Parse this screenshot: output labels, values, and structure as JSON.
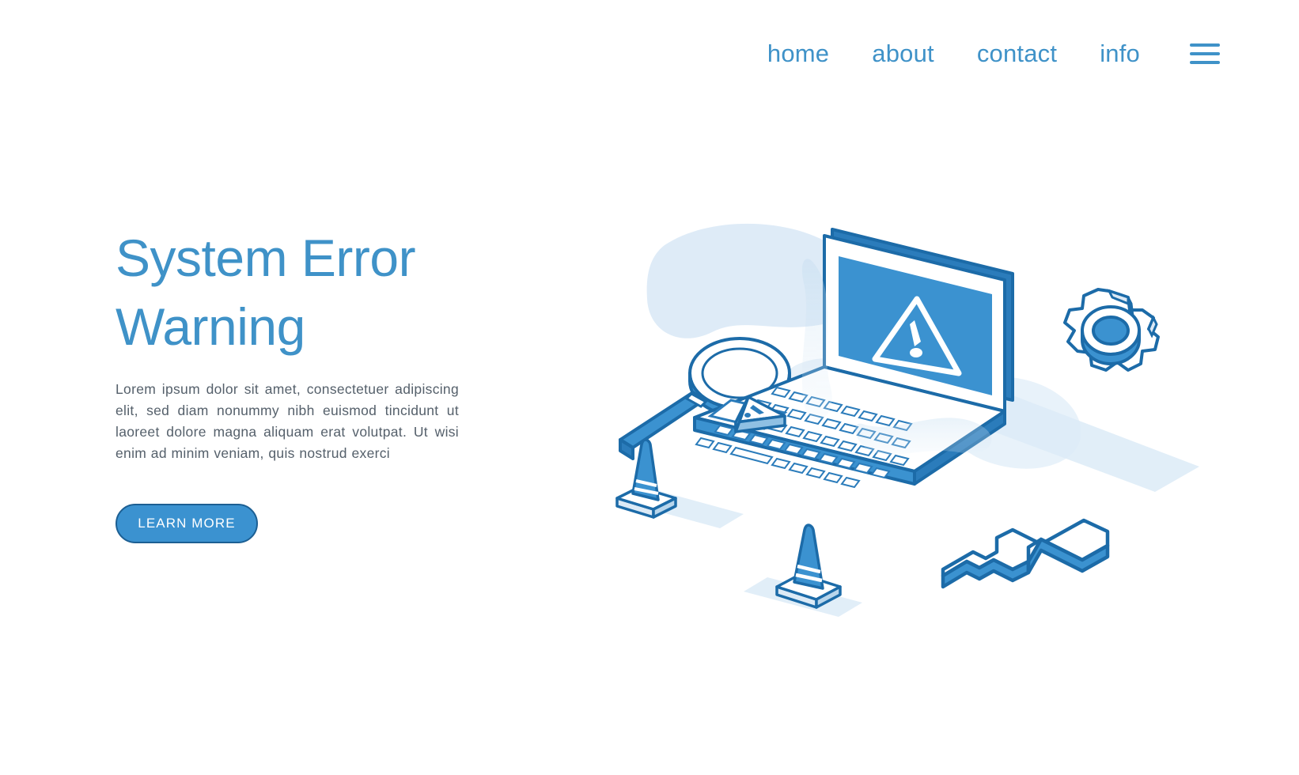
{
  "nav": {
    "items": [
      {
        "label": "home"
      },
      {
        "label": "about"
      },
      {
        "label": "contact"
      },
      {
        "label": "info"
      }
    ],
    "menu_icon": "hamburger-menu-icon"
  },
  "hero": {
    "title_line1": "System Error",
    "title_line2": "Warning",
    "paragraph": "Lorem ipsum dolor sit amet, consectetuer adipiscing elit, sed diam nonummy nibh euismod tincidunt ut laoreet dolore magna aliquam erat volutpat. Ut wisi enim ad minim veniam, quis nostrud exerci",
    "cta_label": "LEARN MORE"
  },
  "illustration": {
    "name": "isometric-laptop-system-error",
    "screen_icon": "warning-triangle-icon",
    "objects": [
      "laptop",
      "magnifying-glass",
      "gear",
      "wrench",
      "traffic-cone",
      "traffic-cone",
      "trackpad-warning-triangle"
    ]
  },
  "colors": {
    "accent_blue": "#3f92c8",
    "screen_blue": "#3b92d0",
    "outline_blue": "#1c6ba8",
    "light_blue": "#d9e8f5",
    "pale_blue": "#eff6fc",
    "text_gray": "#55606b",
    "white": "#ffffff"
  }
}
